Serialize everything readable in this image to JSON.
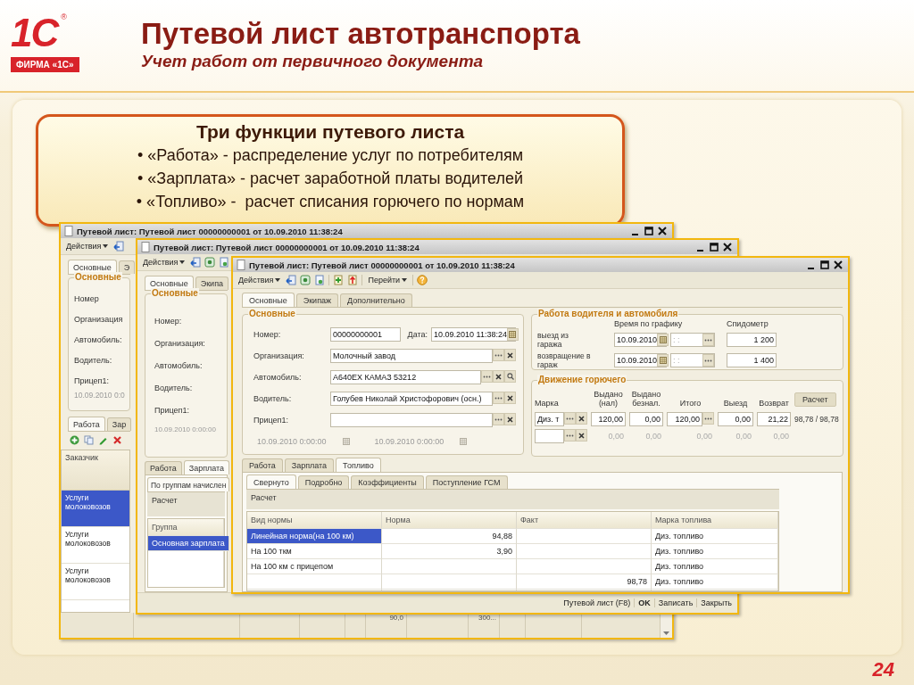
{
  "slide": {
    "logo": {
      "mark": "1С",
      "registered": "®",
      "caption": "ФИРМА «1С»"
    },
    "title": "Путевой лист автотранспорта",
    "subtitle": "Учет работ от первичного документа",
    "page_number": "24"
  },
  "callout": {
    "heading": "Три функции путевого листа",
    "bullets": [
      "• «Работа» - распределение услуг по потребителям",
      "• «Зарплата» - расчет заработной платы водителей",
      "• «Топливо» -  расчет списания горючего по нормам"
    ]
  },
  "back_window": {
    "title": "Путевой лист: Путевой лист 00000000001 от 10.09.2010 11:38:24",
    "actions": "Действия",
    "tabs": [
      {
        "label": "Основные",
        "selected": true
      },
      {
        "label": "Э",
        "selected": false
      }
    ],
    "group_title": "Основные",
    "labels": [
      "Номер",
      "Организация",
      "Автомобиль:",
      "Водитель:",
      "Прицеп1:"
    ],
    "date": "10.09.2010 0:0",
    "bottom_tabs": [
      {
        "label": "Работа",
        "selected": true
      },
      {
        "label": "Зар",
        "selected": false
      }
    ],
    "table": {
      "columns": [
        "Заказчик"
      ],
      "rows": [
        {
          "cells": [
            "Услуги молоковозов"
          ],
          "selected": true
        },
        {
          "cells": [
            "Услуги молоковозов"
          ],
          "selected": false
        },
        {
          "cells": [
            "Услуги молоковозов"
          ],
          "selected": false
        }
      ]
    },
    "footer_cells": [
      "90,0",
      "300..."
    ]
  },
  "middle_window": {
    "title": "Путевой лист: Путевой лист 00000000001 от 10.09.2010 11:38:24",
    "actions": "Действия",
    "tabs": [
      {
        "label": "Основные",
        "selected": true
      },
      {
        "label": "Экипа",
        "selected": false
      }
    ],
    "group_title": "Основные",
    "labels": [
      "Номер:",
      "Организация:",
      "Автомобиль:",
      "Водитель:",
      "Прицеп1:"
    ],
    "date": "10.09.2010  0:00:00",
    "bottom_tabs": [
      {
        "label": "Работа",
        "selected": false
      },
      {
        "label": "Зарплата",
        "selected": true
      }
    ],
    "subtab": "По группам начислен",
    "panel": "Расчет",
    "table": {
      "columns": [
        "Группа"
      ],
      "rows": [
        {
          "cells": [
            "Основная зарплата"
          ],
          "selected": true
        }
      ]
    },
    "buttons": [
      {
        "label": "Путевой лист (F8)",
        "default": false
      },
      {
        "label": "OK",
        "default": true
      },
      {
        "label": "Записать",
        "default": false
      },
      {
        "label": "Закрыть",
        "default": false
      }
    ]
  },
  "front_window": {
    "title": "Путевой лист: Путевой лист 00000000001 от 10.09.2010 11:38:24",
    "actions": "Действия",
    "goto": "Перейти",
    "tabs": [
      {
        "label": "Основные",
        "selected": true
      },
      {
        "label": "Экипаж",
        "selected": false
      },
      {
        "label": "Дополнительно",
        "selected": false
      }
    ],
    "main_group": {
      "title": "Основные",
      "number": {
        "label": "Номер:",
        "value": "00000000001"
      },
      "date": {
        "label": "Дата:",
        "value": "10.09.2010 11:38:24"
      },
      "refs": [
        {
          "label": "Организация:",
          "value": "Молочный завод",
          "search": false
        },
        {
          "label": "Автомобиль:",
          "value": "А640ЕХ КАМАЗ 53212",
          "search": true
        },
        {
          "label": "Водитель:",
          "value": "Голубев Николай Христофорович (осн.)",
          "search": false
        },
        {
          "label": "Прицеп1:",
          "search": false
        }
      ],
      "trailer_dates": [
        "10.09.2010  0:00:00",
        "10.09.2010  0:00:00"
      ]
    },
    "work_group": {
      "title": "Работа водителя и автомобиля",
      "schedule_header": "Время по графику",
      "speedometer_header": "Спидометр",
      "rows": [
        {
          "label": "выезд из гаража",
          "date": "10.09.2010",
          "time": ": :",
          "speedometer": "1 200"
        },
        {
          "label": "возвращение в гараж",
          "date": "10.09.2010",
          "time": ": :",
          "speedometer": "1 400"
        }
      ]
    },
    "fuel_group": {
      "title": "Движение горючего",
      "columns": [
        "Марка",
        "Выдано (нал)",
        "Выдано безнал.",
        "Итого",
        "Выезд",
        "Возврат"
      ],
      "button": "Расчет",
      "rows": [
        {
          "brand": "Диз. т",
          "values": [
            "120,00",
            "0,00",
            "120,00",
            "0,00",
            "21,22"
          ],
          "active": true,
          "summary": "98,78 / 98,78"
        },
        {
          "values": [
            "0,00",
            "0,00",
            "0,00",
            "0,00",
            "0,00"
          ],
          "active": false
        }
      ]
    },
    "bottom_tabs": [
      {
        "label": "Работа",
        "selected": false
      },
      {
        "label": "Зарплата",
        "selected": false
      },
      {
        "label": "Топливо",
        "selected": true
      }
    ],
    "sub_tabs": [
      {
        "label": "Свернуто",
        "selected": true
      },
      {
        "label": "Подробно",
        "selected": false
      },
      {
        "label": "Коэффициенты",
        "selected": false
      },
      {
        "label": "Поступление ГСМ",
        "selected": false
      }
    ],
    "panel": "Расчет",
    "table": {
      "columns": [
        "Вид нормы",
        "Норма",
        "Факт",
        "Марка топлива"
      ],
      "rows": [
        {
          "cells": [
            "Линейная норма(на 100 км)",
            "94,88",
            null,
            "Диз. топливо"
          ],
          "selected": true
        },
        {
          "cells": [
            "На 100 ткм",
            "3,90",
            null,
            "Диз. топливо"
          ],
          "selected": false
        },
        {
          "cells": [
            "На 100 км с прицепом",
            null,
            null,
            "Диз. топливо"
          ],
          "selected": false
        },
        {
          "cells": [
            null,
            null,
            "98,78",
            "Диз. топливо"
          ],
          "selected": false
        }
      ]
    }
  }
}
